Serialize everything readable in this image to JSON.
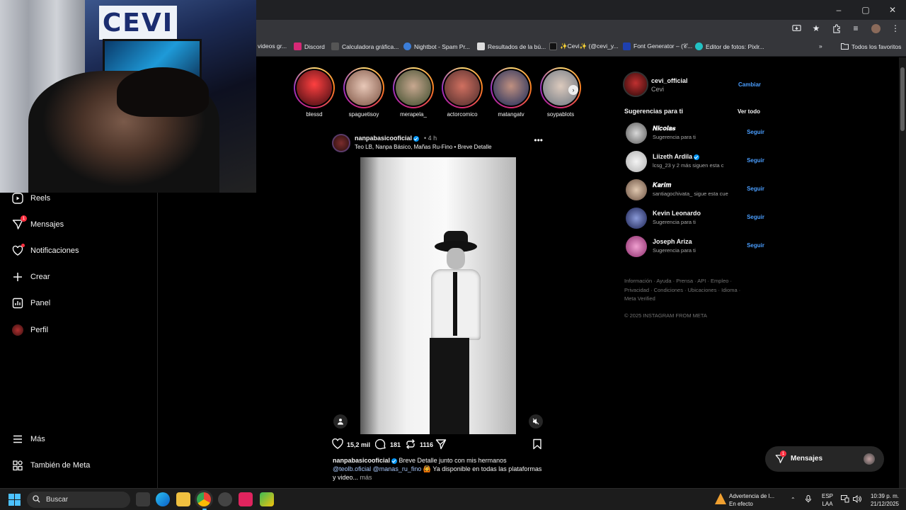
{
  "browser": {
    "window_controls": [
      "–",
      "▢",
      "✕"
    ],
    "bookmarks": [
      {
        "label": "videos gr...",
        "color": "#888888"
      },
      {
        "label": "Discord",
        "color": "#d62976"
      },
      {
        "label": "Calculadora gráfica...",
        "color": "#666666"
      },
      {
        "label": "Nightbot - Spam Pr...",
        "color": "#3b7dd8"
      },
      {
        "label": "Resultados de la bú...",
        "color": "#dddddd"
      },
      {
        "label": "✨Cevi✨ (@cevi_y...",
        "color": "#111111"
      },
      {
        "label": "Font Generator – (𝒞...",
        "color": "#1e40af"
      },
      {
        "label": "Editor de fotos: Pixlr...",
        "color": "#22c1c3"
      }
    ],
    "all_bookmarks": "Todos los favoritos"
  },
  "webcam": {
    "banner_text": "CEVI"
  },
  "sidebar": {
    "items": [
      {
        "label": "Reels",
        "icon": "reels-icon"
      },
      {
        "label": "Mensajes",
        "icon": "messages-icon",
        "badge": "1"
      },
      {
        "label": "Notificaciones",
        "icon": "heart-icon"
      },
      {
        "label": "Crear",
        "icon": "plus-icon"
      },
      {
        "label": "Panel",
        "icon": "dashboard-icon"
      },
      {
        "label": "Perfil",
        "icon": "profile-avatar"
      }
    ],
    "bottom": [
      {
        "label": "Más",
        "icon": "menu-icon"
      },
      {
        "label": "También de Meta",
        "icon": "meta-icon"
      }
    ]
  },
  "stories": [
    {
      "username": "blessd",
      "color": "#8a1c2a"
    },
    {
      "username": "spaguetisoy",
      "color": "#d8b8a8"
    },
    {
      "username": "merapela_",
      "color": "#6a7a5a"
    },
    {
      "username": "actorcomico",
      "color": "#8b4a3a"
    },
    {
      "username": "matangatv",
      "color": "#2a3a6a"
    },
    {
      "username": "soypablots",
      "color": "#9aa4b0"
    }
  ],
  "post": {
    "username": "nanpabasicooficial",
    "time": "• 4 h",
    "subtitle": "Teo LB, Nanpa Básico, Mañas Ru-Fino • Breve Detalle",
    "likes": "15,2 mil",
    "comments": "181",
    "reposts": "1116",
    "caption_user": "nanpabasicooficial",
    "caption_text": "Breve Detalle junto con mis hermanos",
    "caption_mentions": "@teolb.oficial @manas_ru_fino",
    "caption_rest": "🙆 Ya disponible en todas las plataformas y video...",
    "more": "más"
  },
  "right": {
    "account_username": "cevi_official",
    "account_name": "Cevi",
    "switch_label": "Cambiar",
    "suggestions_title": "Sugerencias para ti",
    "see_all": "Ver todo",
    "suggestions": [
      {
        "name": "𝑵𝒊𝒄𝒐𝒍𝒂𝒔",
        "sub": "Sugerencia para ti",
        "verified": false,
        "color": "#9a9a9a"
      },
      {
        "name": "Liizeth Ardila",
        "sub": "lcsg_23 y 2 más siguen esta c",
        "verified": true,
        "color": "#e6e6e6"
      },
      {
        "name": "𝑲𝒂𝒓𝒊𝒎",
        "sub": "santiagochivata_ sigue esta cue",
        "verified": false,
        "color": "#b8a090"
      },
      {
        "name": "Kevin Leonardo",
        "sub": "Sugerencia para ti",
        "verified": false,
        "color": "#3a4a9a"
      },
      {
        "name": "Joseph Ariza",
        "sub": "Sugerencia para ti",
        "verified": false,
        "color": "#c84a9a"
      }
    ],
    "follow_label": "Seguir",
    "footer_line1": "Información · Ayuda · Prensa · API · Empleo ·",
    "footer_line2": "Privacidad · Condiciones · Ubicaciones · Idioma ·",
    "footer_line3": "Meta Verified",
    "copyright": "© 2025 INSTAGRAM FROM META"
  },
  "messages_pill": {
    "label": "Mensajes",
    "badge": "1"
  },
  "taskbar": {
    "search": "Buscar",
    "alert_title": "Advertencia de l...",
    "alert_sub": "En efecto",
    "lang1": "ESP",
    "lang2": "LAA",
    "time": "10:39 p. m.",
    "date": "21/12/2025"
  }
}
